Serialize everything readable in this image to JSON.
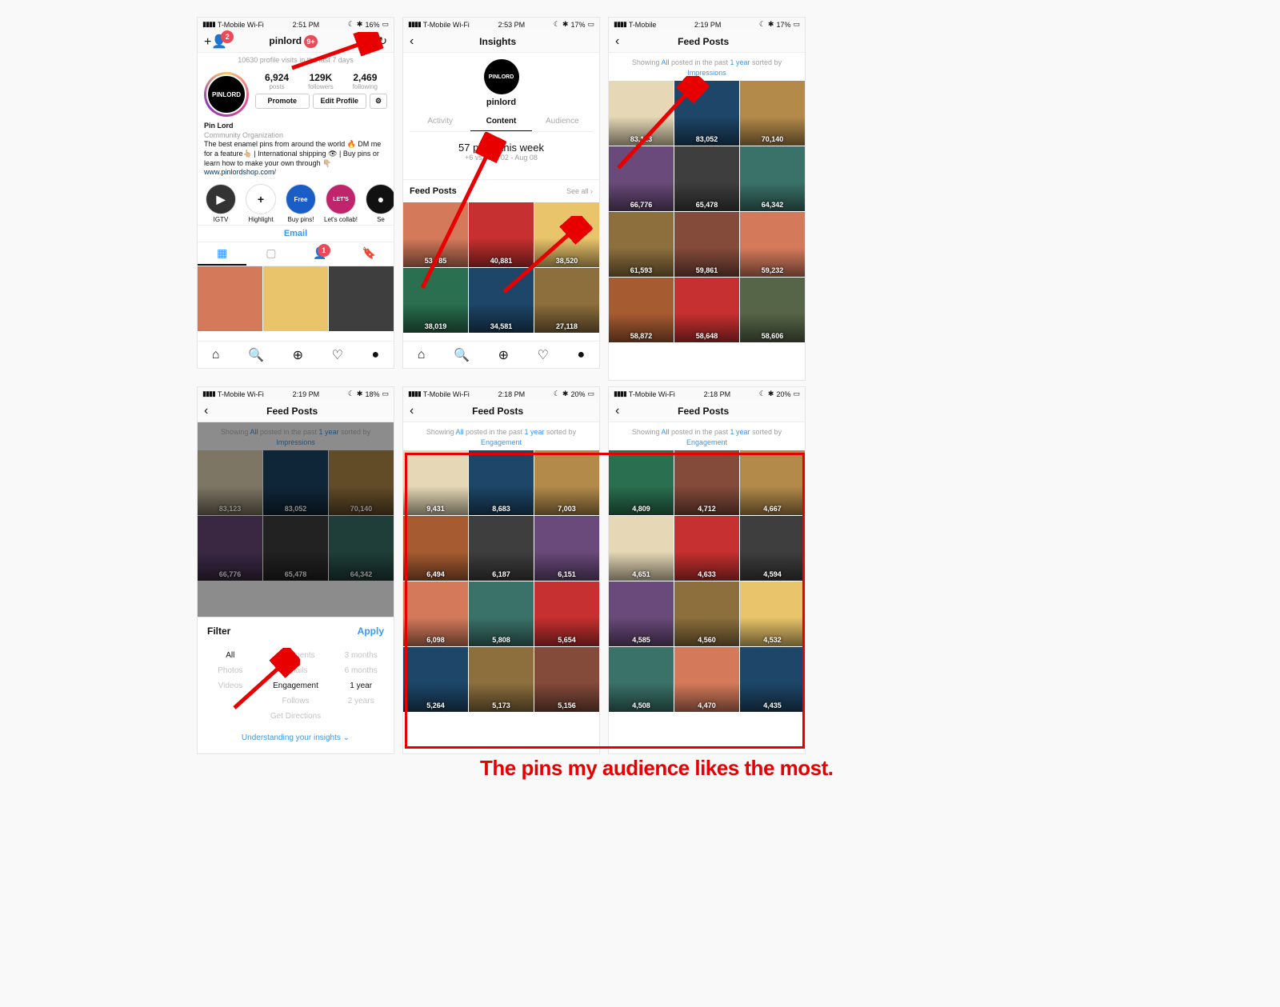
{
  "statusbars": {
    "a": {
      "carrier": "T-Mobile Wi-Fi",
      "time": "2:51 PM",
      "battery": "16%"
    },
    "b": {
      "carrier": "T-Mobile Wi-Fi",
      "time": "2:53 PM",
      "battery": "17%"
    },
    "c": {
      "carrier": "T-Mobile",
      "time": "2:19 PM",
      "battery": "17%"
    },
    "d": {
      "carrier": "T-Mobile Wi-Fi",
      "time": "2:19 PM",
      "battery": "18%"
    },
    "e": {
      "carrier": "T-Mobile Wi-Fi",
      "time": "2:18 PM",
      "battery": "20%"
    },
    "f": {
      "carrier": "T-Mobile Wi-Fi",
      "time": "2:18 PM",
      "battery": "20%"
    }
  },
  "profile": {
    "username": "pinlord",
    "notif": "9+",
    "discover_badge": "2",
    "profile_visits": "10630 profile visits in the last 7 days",
    "avatar_text": "PINLORD",
    "stats": {
      "posts_n": "6,924",
      "posts_l": "posts",
      "followers_n": "129K",
      "followers_l": "followers",
      "following_n": "2,469",
      "following_l": "following"
    },
    "promote": "Promote",
    "edit_profile": "Edit Profile",
    "bio_name": "Pin Lord",
    "bio_cat": "Community Organization",
    "bio_text": "The best enamel pins from around the world 🔥 DM me for a feature👆🏼 | International shipping 👁 | Buy pins or learn how to make your own through 👇🏼",
    "bio_link": "www.pinlordshop.com/",
    "highlights": [
      {
        "label": "IGTV",
        "circ": "▶"
      },
      {
        "label": "Highlight",
        "circ": "+"
      },
      {
        "label": "Buy pins!",
        "circ": "F",
        "bg": "#1a5dc7",
        "fg": "#fff",
        "txt": "Free"
      },
      {
        "label": "Let's collab!",
        "circ": "L",
        "bg": "#c0246d",
        "fg": "#fff",
        "txt": "LET'S"
      },
      {
        "label": "Se",
        "circ": "●"
      }
    ],
    "email": "Email",
    "tag_badge": "1"
  },
  "insights": {
    "title": "Insights",
    "username": "pinlord",
    "tabs": {
      "activity": "Activity",
      "content": "Content",
      "audience": "Audience"
    },
    "posts_week": "57 posts this week",
    "posts_week_sub": "+6 vs. Aug 02 - Aug 08",
    "feed_posts": "Feed Posts",
    "see_all": "See all",
    "thumbs": [
      {
        "c": "c1",
        "n": "53,785"
      },
      {
        "c": "c2",
        "n": "40,881"
      },
      {
        "c": "c3",
        "n": "38,520"
      },
      {
        "c": "c4",
        "n": "38,019"
      },
      {
        "c": "c5",
        "n": "34,581"
      },
      {
        "c": "c6",
        "n": "27,118"
      }
    ]
  },
  "feed_header": "Feed Posts",
  "filter_sentence": {
    "pre": "Showing ",
    "all": "All",
    "mid1": " posted in the past ",
    "year": "1 year",
    "mid2": " sorted by "
  },
  "sort_imp": "Impressions",
  "sort_eng": "Engagement",
  "grid_imp": [
    {
      "c": "c7",
      "n": "83,123"
    },
    {
      "c": "c5",
      "n": "83,052"
    },
    {
      "c": "c8",
      "n": "70,140"
    },
    {
      "c": "c12",
      "n": "66,776"
    },
    {
      "c": "c10",
      "n": "65,478"
    },
    {
      "c": "c9",
      "n": "64,342"
    },
    {
      "c": "c6",
      "n": "61,593"
    },
    {
      "c": "c11",
      "n": "59,861"
    },
    {
      "c": "c1",
      "n": "59,232"
    },
    {
      "c": "c13",
      "n": "58,872"
    },
    {
      "c": "c2",
      "n": "58,648"
    },
    {
      "c": "c14",
      "n": "58,606"
    }
  ],
  "grid_eng1": [
    {
      "c": "c7",
      "n": "9,431"
    },
    {
      "c": "c5",
      "n": "8,683"
    },
    {
      "c": "c8",
      "n": "7,003"
    },
    {
      "c": "c13",
      "n": "6,494"
    },
    {
      "c": "c10",
      "n": "6,187"
    },
    {
      "c": "c12",
      "n": "6,151"
    },
    {
      "c": "c1",
      "n": "6,098"
    },
    {
      "c": "c9",
      "n": "5,808"
    },
    {
      "c": "c2",
      "n": "5,654"
    },
    {
      "c": "c5",
      "n": "5,264"
    },
    {
      "c": "c6",
      "n": "5,173"
    },
    {
      "c": "c11",
      "n": "5,156"
    }
  ],
  "grid_eng2": [
    {
      "c": "c4",
      "n": "4,809"
    },
    {
      "c": "c11",
      "n": "4,712"
    },
    {
      "c": "c8",
      "n": "4,667"
    },
    {
      "c": "c7",
      "n": "4,651"
    },
    {
      "c": "c2",
      "n": "4,633"
    },
    {
      "c": "c10",
      "n": "4,594"
    },
    {
      "c": "c12",
      "n": "4,585"
    },
    {
      "c": "c6",
      "n": "4,560"
    },
    {
      "c": "c3",
      "n": "4,532"
    },
    {
      "c": "c9",
      "n": "4,508"
    },
    {
      "c": "c1",
      "n": "4,470"
    },
    {
      "c": "c5",
      "n": "4,435"
    }
  ],
  "filter_sheet": {
    "title": "Filter",
    "apply": "Apply",
    "col1": [
      "All",
      "Photos",
      "Videos"
    ],
    "col2": [
      "Comments",
      "Emails",
      "Engagement",
      "Follows",
      "Get Directions"
    ],
    "col3": [
      "3 months",
      "6 months",
      "1 year",
      "2 years"
    ],
    "understanding": "Understanding your insights"
  },
  "caption": "The pins my audience likes the most."
}
